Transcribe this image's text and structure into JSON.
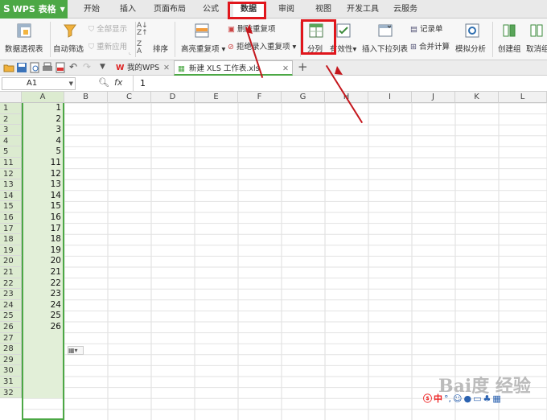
{
  "app": {
    "name": "WPS 表格",
    "icon": "S"
  },
  "menu_tabs": [
    "开始",
    "插入",
    "页面布局",
    "公式",
    "数据",
    "审阅",
    "视图",
    "开发工具",
    "云服务"
  ],
  "active_tab": "数据",
  "ribbon": {
    "pivot": "数据透视表",
    "auto_filter": "自动筛选",
    "show_all": "全部显示",
    "reapply": "重新应用",
    "sort": "排序",
    "highlight_dup": "高亮重复项",
    "remove_dup": "删除重复项",
    "reject_dup": "拒绝录入重复项",
    "split_columns": "分列",
    "validity": "有效性",
    "insert_dropdown": "插入下拉列表",
    "record_form": "记录单",
    "consolidate": "合并计算",
    "what_if": "模拟分析",
    "create_group": "创建组",
    "ungroup": "取消组"
  },
  "doc_tabs": [
    {
      "label": "我的WPS",
      "closable": true
    },
    {
      "label": "新建 XLS 工作表.xls",
      "closable": true
    }
  ],
  "formula_bar": {
    "name_box": "A1",
    "fx": "fx",
    "value": "1"
  },
  "columns": [
    "A",
    "B",
    "C",
    "D",
    "E",
    "F",
    "G",
    "H",
    "I",
    "J",
    "K",
    "L"
  ],
  "rows": [
    {
      "num": "1",
      "value": "1"
    },
    {
      "num": "2",
      "value": "2"
    },
    {
      "num": "3",
      "value": "3"
    },
    {
      "num": "4",
      "value": "4"
    },
    {
      "num": "5",
      "value": "5"
    },
    {
      "num": "11",
      "value": "11"
    },
    {
      "num": "12",
      "value": "12"
    },
    {
      "num": "13",
      "value": "13"
    },
    {
      "num": "14",
      "value": "14"
    },
    {
      "num": "15",
      "value": "15"
    },
    {
      "num": "16",
      "value": "16"
    },
    {
      "num": "17",
      "value": "17"
    },
    {
      "num": "18",
      "value": "18"
    },
    {
      "num": "19",
      "value": "19"
    },
    {
      "num": "20",
      "value": "20"
    },
    {
      "num": "21",
      "value": "21"
    },
    {
      "num": "22",
      "value": "22"
    },
    {
      "num": "23",
      "value": "23"
    },
    {
      "num": "24",
      "value": "24"
    },
    {
      "num": "25",
      "value": "25"
    },
    {
      "num": "26",
      "value": "26"
    },
    {
      "num": "27",
      "value": ""
    },
    {
      "num": "28",
      "value": ""
    },
    {
      "num": "29",
      "value": ""
    },
    {
      "num": "30",
      "value": ""
    },
    {
      "num": "31",
      "value": ""
    },
    {
      "num": "32",
      "value": ""
    }
  ],
  "ime_bar": {
    "lang": "中"
  },
  "watermark": "Bai度 经验",
  "colors": {
    "accent": "#4ca845",
    "highlight": "#e0161c",
    "selection": "#dcebd0"
  }
}
